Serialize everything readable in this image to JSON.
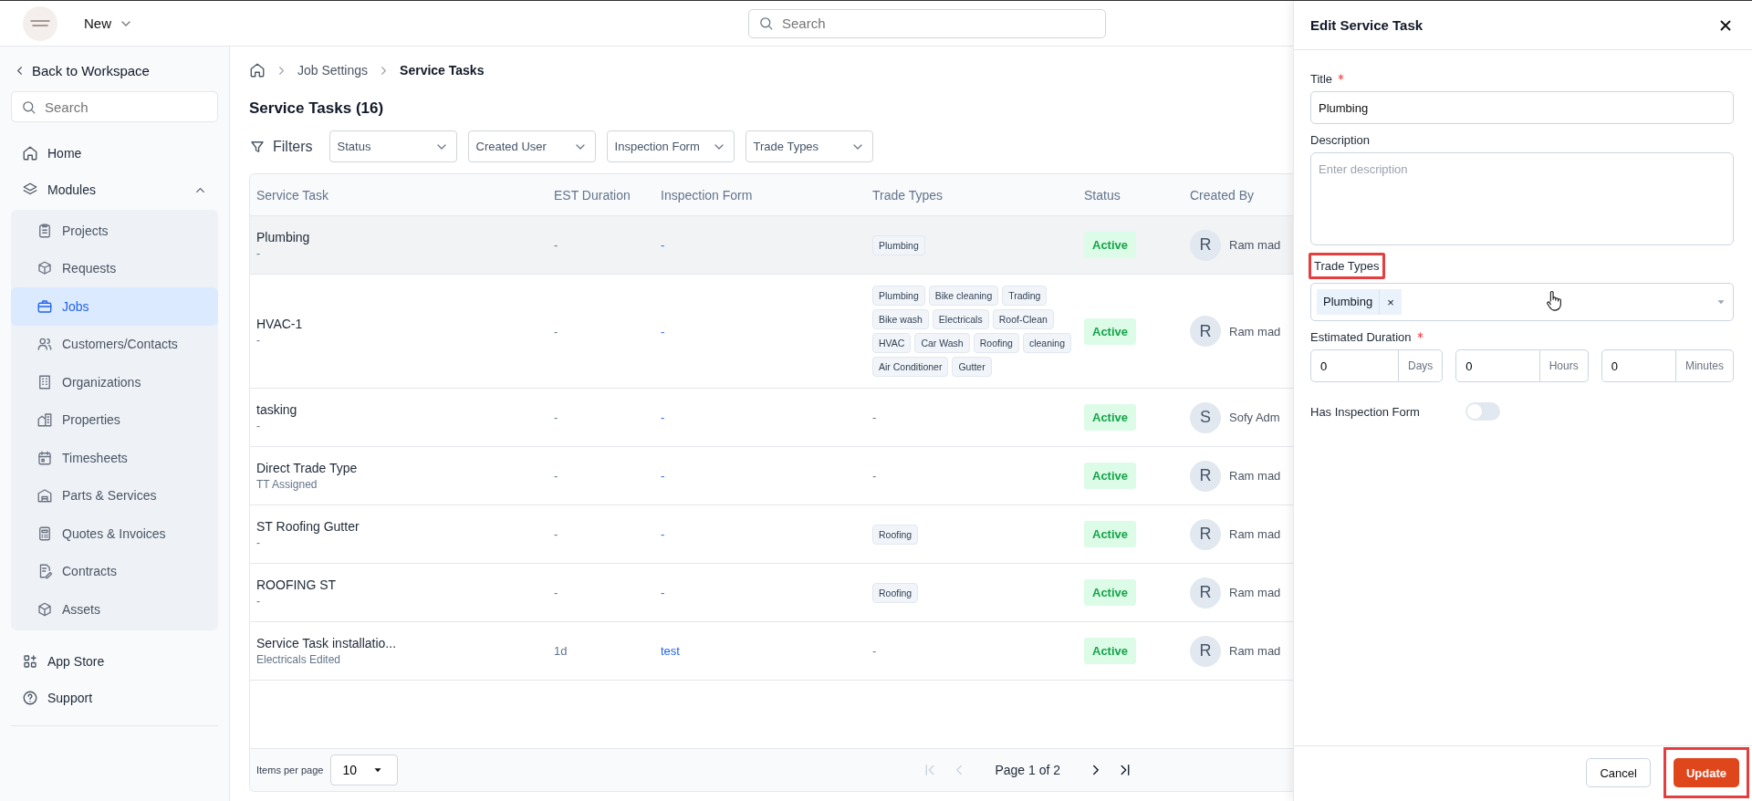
{
  "top_bar": {
    "new_label": "New",
    "search": {
      "placeholder": "Search"
    }
  },
  "sidebar": {
    "back_label": "Back to Workspace",
    "search": {
      "placeholder": "Search"
    },
    "items": [
      {
        "label": "Home",
        "selected": false
      },
      {
        "label": "Modules",
        "expanded": true,
        "children": [
          {
            "label": "Projects",
            "selected": false
          },
          {
            "label": "Requests",
            "selected": false
          },
          {
            "label": "Jobs",
            "selected": true
          },
          {
            "label": "Customers/Contacts",
            "selected": false
          },
          {
            "label": "Organizations",
            "selected": false
          },
          {
            "label": "Properties",
            "selected": false
          },
          {
            "label": "Timesheets",
            "selected": false
          },
          {
            "label": "Parts & Services",
            "selected": false
          },
          {
            "label": "Quotes & Invoices",
            "selected": false
          },
          {
            "label": "Contracts",
            "selected": false
          },
          {
            "label": "Assets",
            "selected": false
          }
        ]
      }
    ],
    "bottom_items": [
      {
        "label": "App Store"
      },
      {
        "label": "Support"
      }
    ]
  },
  "breadcrumb": [
    "Job Settings",
    "Service Tasks"
  ],
  "page_title": "Service Tasks (16)",
  "filters": {
    "label": "Filters",
    "dropdowns": [
      "Status",
      "Created User",
      "Inspection Form",
      "Trade Types"
    ]
  },
  "table": {
    "columns": [
      "Service Task",
      "EST Duration",
      "Inspection Form",
      "Trade Types",
      "Status",
      "Created By"
    ],
    "rows": [
      {
        "selected": true,
        "name": "Plumbing",
        "sub": "-",
        "duration": "-",
        "form": "-",
        "trade_types": [
          "Plumbing"
        ],
        "status": "Active",
        "avatar": "R",
        "created_by": "Ram mad"
      },
      {
        "selected": false,
        "name": "HVAC-1",
        "sub": "-",
        "duration": "-",
        "form": "-",
        "trade_types": [
          "Plumbing",
          "Bike cleaning",
          "Trading",
          "Bike wash",
          "Electricals",
          "Roof-Clean",
          "HVAC",
          "Car Wash",
          "Roofing",
          "cleaning",
          "Air Conditioner",
          "Gutter"
        ],
        "status": "Active",
        "avatar": "R",
        "created_by": "Ram mad"
      },
      {
        "selected": false,
        "name": "tasking",
        "sub": "-",
        "duration": "-",
        "form": "-",
        "trade_types": "-",
        "status": "Active",
        "avatar": "S",
        "created_by": "Sofy Adm"
      },
      {
        "selected": false,
        "name": "Direct Trade Type",
        "sub": "TT Assigned",
        "duration": "-",
        "form": "-",
        "trade_types": "-",
        "status": "Active",
        "avatar": "R",
        "created_by": "Ram mad"
      },
      {
        "selected": false,
        "name": "ST Roofing Gutter",
        "sub": "-",
        "duration": "-",
        "form": "-",
        "trade_types": [
          "Roofing"
        ],
        "status": "Active",
        "avatar": "R",
        "created_by": "Ram mad"
      },
      {
        "selected": false,
        "name": "ROOFING ST",
        "sub": "-",
        "duration": "-",
        "form": "-",
        "trade_types": [
          "Roofing"
        ],
        "status": "Active",
        "avatar": "R",
        "created_by": "Ram mad"
      },
      {
        "selected": false,
        "name": "Service Task installatio...",
        "sub": "Electricals Edited",
        "duration": "1d",
        "form": "test",
        "trade_types": "-",
        "status": "Active",
        "avatar": "R",
        "created_by": "Ram mad"
      }
    ]
  },
  "pagination": {
    "items_per_page_label": "Items per page",
    "items_per_page": "10",
    "page_text": "Page 1 of 2",
    "buttons": [
      {
        "kind": "first",
        "disabled": true
      },
      {
        "kind": "prev",
        "disabled": true
      },
      {
        "kind": "next",
        "disabled": false
      },
      {
        "kind": "last",
        "disabled": false
      }
    ]
  },
  "panel": {
    "title": "Edit Service Task",
    "title_field": {
      "label": "Title",
      "required": true,
      "value": "Plumbing"
    },
    "description_field": {
      "label": "Description",
      "required": false,
      "placeholder": "Enter description"
    },
    "trade_types_field": {
      "label": "Trade Types",
      "highlighted": true,
      "chips": [
        "Plumbing"
      ],
      "chip_remove": "×"
    },
    "duration": {
      "label": "Estimated Duration",
      "required": true,
      "parts": [
        {
          "value": "0",
          "unit": "Days"
        },
        {
          "value": "0",
          "unit": "Hours"
        },
        {
          "value": "0",
          "unit": "Minutes"
        }
      ]
    },
    "inspection_toggle": {
      "label": "Has Inspection Form",
      "on": false
    },
    "buttons": [
      {
        "kind": "secondary",
        "label": "Cancel",
        "highlighted": false
      },
      {
        "kind": "primary",
        "label": "Update",
        "highlighted": true
      }
    ]
  }
}
